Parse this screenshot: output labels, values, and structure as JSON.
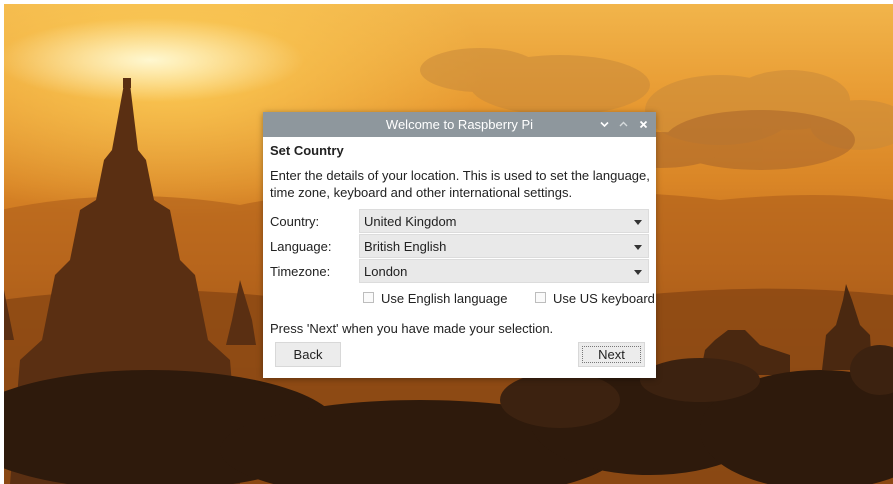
{
  "dialog": {
    "title": "Welcome to Raspberry Pi",
    "heading": "Set Country",
    "description": "Enter the details of your location. This is used to set the language, time zone, keyboard and other international settings.",
    "fields": {
      "country_label": "Country:",
      "country_value": "United Kingdom",
      "language_label": "Language:",
      "language_value": "British English",
      "timezone_label": "Timezone:",
      "timezone_value": "London"
    },
    "checkboxes": {
      "english_label": "Use English language",
      "english_checked": false,
      "us_keyboard_label": "Use US keyboard",
      "us_keyboard_checked": false
    },
    "footer_text": "Press 'Next' when you have made your selection.",
    "buttons": {
      "back": "Back",
      "next": "Next"
    },
    "titlebar_icons": [
      "chevron-down-icon",
      "chevron-up-icon",
      "close-icon"
    ]
  },
  "colors": {
    "titlebar": "#8e979d",
    "combo_bg": "#e9e9e9",
    "sky_top": "#f2b64c",
    "ground": "#2a1a0e"
  }
}
